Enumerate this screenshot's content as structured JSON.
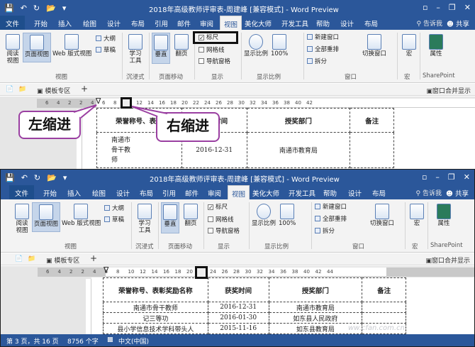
{
  "windows": [
    {
      "title": "2018年高级教师评审表-周建峰 [兼容模式] - Word Preview",
      "tabs": [
        "文件",
        "开始",
        "插入",
        "绘图",
        "设计",
        "布局",
        "引用",
        "邮件",
        "审阅",
        "视图",
        "美化大师",
        "开发工具",
        "帮助",
        "设计",
        "布局"
      ],
      "active_tab": "视图",
      "tell_me": "告诉我",
      "share": "共享",
      "ribbon": {
        "views": {
          "read": "阅读\n视图",
          "print": "页面视图",
          "web": "Web 版式视图",
          "group": "视图"
        },
        "outline": "大纲",
        "draft": "草稿",
        "immersive": {
          "learn": "学习\n工具",
          "group": "沉浸式"
        },
        "move": {
          "vertical": "垂直",
          "side": "翻页",
          "group": "页面移动"
        },
        "show": {
          "ruler": "标尺",
          "grid": "网格线",
          "nav": "导航窗格",
          "group": "显示"
        },
        "zoom": {
          "zoom": "显示比例",
          "p100": "100%",
          "group": "显示比例"
        },
        "window": {
          "new": "新建窗口",
          "arrange": "全部重排",
          "split": "拆分",
          "switch": "切换窗口",
          "group": "窗口"
        },
        "macro": {
          "label": "宏",
          "group": "宏"
        },
        "sharepoint": {
          "label": "属性",
          "group": "SharePoint"
        }
      },
      "panel": {
        "template": "模板专区",
        "merge": "窗口合并显示"
      },
      "ruler_numbers": [
        "6",
        "4",
        "2",
        "2",
        "4",
        "6",
        "8",
        "10",
        "12",
        "14",
        "16",
        "18",
        "20",
        "22",
        "24",
        "26",
        "28",
        "30",
        "32",
        "34",
        "36",
        "38",
        "40",
        "42"
      ]
    },
    {
      "title": "2018年高级教师评审表-周建峰 [兼容模式] - Word Preview",
      "tabs": [
        "文件",
        "开始",
        "插入",
        "绘图",
        "设计",
        "布局",
        "引用",
        "邮件",
        "审阅",
        "视图",
        "美化大师",
        "开发工具",
        "帮助",
        "设计",
        "布局"
      ],
      "active_tab": "视图",
      "tell_me": "告诉我",
      "share": "共享",
      "panel": {
        "template": "模板专区",
        "merge": "窗口合并显示"
      },
      "ruler_numbers": [
        "6",
        "4",
        "2",
        "2",
        "4",
        "6",
        "8",
        "10",
        "12",
        "14",
        "16",
        "18",
        "20",
        "22",
        "24",
        "26",
        "28",
        "30",
        "32",
        "34",
        "36",
        "38",
        "40",
        "42",
        "44"
      ]
    }
  ],
  "callouts": {
    "left": "左缩进",
    "right": "右缩进"
  },
  "table_top": {
    "headers": [
      "荣誉称号、表彰",
      "授奖时间",
      "授奖部门",
      "备注"
    ],
    "row": [
      "南通市\n骨干教\n师",
      "2016-12-31",
      "南通市教育局",
      ""
    ]
  },
  "table_bottom": {
    "headers": [
      "荣誉称号、表彰奖励名称",
      "获奖时间",
      "授奖部门",
      "备注"
    ],
    "rows": [
      [
        "南通市骨干教师",
        "2016-12-31",
        "南通市教育局",
        ""
      ],
      [
        "记三等功",
        "2016-01-30",
        "如东县人民政府",
        ""
      ],
      [
        "县小学信息技术学科带头人",
        "2015-11-16",
        "如东县教育局",
        ""
      ]
    ]
  },
  "status": {
    "page": "第 3 页，共 16 页",
    "words": "8756 个字",
    "lang": "中文(中国)"
  },
  "watermark": "ww.cfan.com.cn",
  "colors": {
    "accent": "#2b579a",
    "callout_border": "#9a3fa1"
  }
}
